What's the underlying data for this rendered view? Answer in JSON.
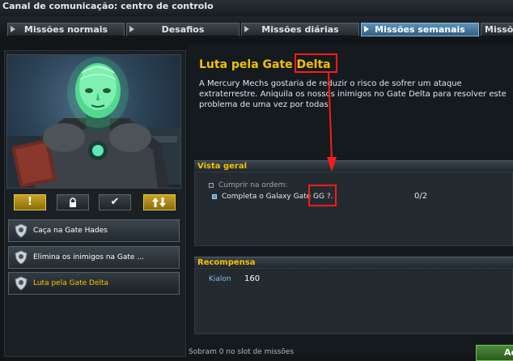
{
  "window": {
    "title": "Canal de comunicação: centro de controlo"
  },
  "tabs": [
    {
      "label": "Missões normais",
      "active": false
    },
    {
      "label": "Desafios",
      "active": false
    },
    {
      "label": "Missões diárias",
      "active": false
    },
    {
      "label": "Missões semanais",
      "active": true
    },
    {
      "label": "Missões",
      "active": false
    }
  ],
  "action_buttons": [
    {
      "icon": "exclamation-icon",
      "symbol": "!"
    },
    {
      "icon": "lock-icon"
    },
    {
      "icon": "checkmark-icon",
      "symbol": "✔"
    },
    {
      "icon": "sort-arrows-icon"
    }
  ],
  "missions": [
    {
      "label": "Caça na Gate Hades",
      "active": false
    },
    {
      "label": "Elimina os inimigos na Gate ...",
      "active": false
    },
    {
      "label": "Luta pela Gate Delta",
      "active": true
    }
  ],
  "mission_detail": {
    "title": "Luta pela Gate Delta",
    "description": "A Mercury Mechs gostaria de reduzir o risco de sofrer um ataque extraterrestre. Aniquila os nossos inimigos no Gate Delta para resolver este problema de uma vez por todas."
  },
  "overview": {
    "heading": "Vista geral",
    "order_label": "Cumprir na ordem:",
    "objective": "Completa o Galaxy Gate GG ?.",
    "progress": "0/2"
  },
  "reward": {
    "heading": "Recompensa",
    "label": "Kialon",
    "value": "160"
  },
  "footer": {
    "remaining_text": "Sobram  0 no slot de missões",
    "accept_label": "Ac"
  },
  "colors": {
    "accent_yellow": "#f2c200",
    "active_tab_blue": "#4a7fa8",
    "annotation_red": "#ff1a1a",
    "reward_label_blue": "#7fc0e6"
  }
}
